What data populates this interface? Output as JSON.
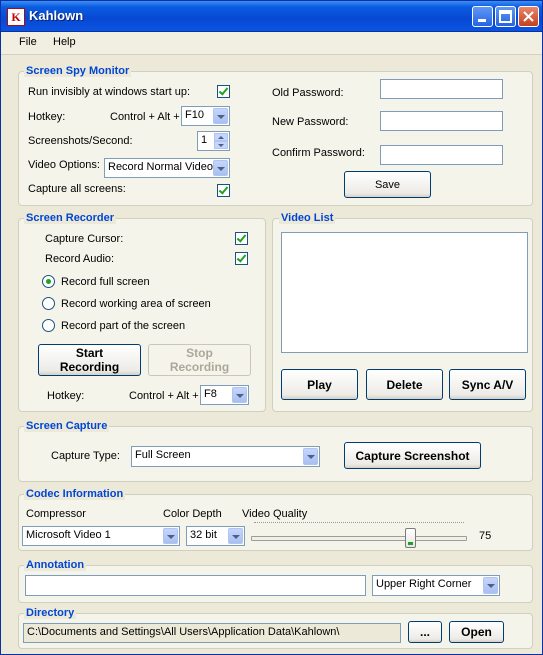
{
  "window": {
    "title": "Kahlown",
    "icon_letter": "K",
    "controls": [
      "minimize-icon",
      "maximize-icon",
      "close-icon"
    ]
  },
  "menu": {
    "items": [
      "File",
      "Help"
    ]
  },
  "spy": {
    "title": "Screen Spy Monitor",
    "run_invisibly_label": "Run invisibly at windows start up:",
    "run_invisibly_checked": true,
    "hotkey_label": "Hotkey:",
    "hotkey_prefix": "Control + Alt +",
    "hotkey_value": "F10",
    "screenshots_label": "Screenshots/Second:",
    "screenshots_value": "1",
    "video_options_label": "Video Options:",
    "video_options_value": "Record Normal Video",
    "capture_all_label": "Capture all screens:",
    "capture_all_checked": true,
    "old_password_label": "Old Password:",
    "new_password_label": "New Password:",
    "confirm_password_label": "Confirm Password:",
    "save_label": "Save"
  },
  "recorder": {
    "title": "Screen Recorder",
    "capture_cursor_label": "Capture Cursor:",
    "capture_cursor_checked": true,
    "record_audio_label": "Record Audio:",
    "record_audio_checked": true,
    "options": [
      "Record full screen",
      "Record working area of screen",
      "Record part of the screen"
    ],
    "selected_option": 0,
    "start_label": "Start Recording",
    "stop_label": "Stop Recording",
    "hotkey_label": "Hotkey:",
    "hotkey_prefix": "Control + Alt +",
    "hotkey_value": "F8"
  },
  "video_list": {
    "title": "Video List",
    "play_label": "Play",
    "delete_label": "Delete",
    "sync_label": "Sync A/V"
  },
  "capture": {
    "title": "Screen Capture",
    "type_label": "Capture Type:",
    "type_value": "Full Screen",
    "button_label": "Capture Screenshot"
  },
  "codec": {
    "title": "Codec Information",
    "compressor_label": "Compressor",
    "compressor_value": "Microsoft Video 1",
    "color_depth_label": "Color Depth",
    "color_depth_value": "32 bit",
    "quality_label": "Video Quality",
    "quality_value": "75"
  },
  "annotation": {
    "title": "Annotation",
    "text_value": "",
    "position_value": "Upper Right Corner"
  },
  "directory": {
    "title": "Directory",
    "path": "C:\\Documents and Settings\\All Users\\Application Data\\Kahlown\\",
    "browse_label": "...",
    "open_label": "Open"
  },
  "colors": {
    "group_title": "#0046d5",
    "titlebar": "#0a5ce0",
    "check": "#21a121"
  }
}
